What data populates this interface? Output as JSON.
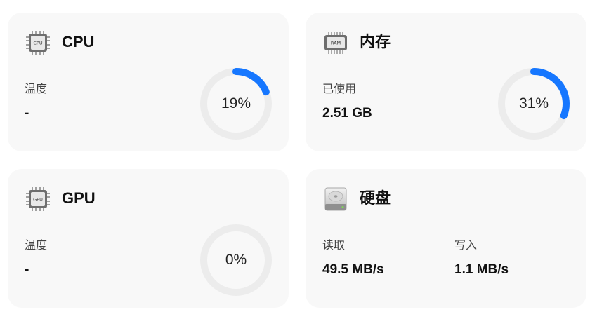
{
  "colors": {
    "accent": "#1677ff",
    "track": "#ececec",
    "card_bg": "#f8f8f8"
  },
  "cards": {
    "cpu": {
      "icon": "cpu-chip-icon",
      "icon_label": "CPU",
      "title": "CPU",
      "metric_label": "温度",
      "metric_value": "-",
      "usage_text": "19%",
      "usage_fraction": 0.19
    },
    "memory": {
      "icon": "ram-chip-icon",
      "icon_label": "RAM",
      "title": "内存",
      "metric_label": "已使用",
      "metric_value": "2.51 GB",
      "usage_text": "31%",
      "usage_fraction": 0.31
    },
    "gpu": {
      "icon": "gpu-chip-icon",
      "icon_label": "GPU",
      "title": "GPU",
      "metric_label": "温度",
      "metric_value": "-",
      "usage_text": "0%",
      "usage_fraction": 0.0
    },
    "disk": {
      "icon": "hard-drive-icon",
      "title": "硬盘",
      "read_label": "读取",
      "read_value": "49.5 MB/s",
      "write_label": "写入",
      "write_value": "1.1 MB/s"
    }
  }
}
